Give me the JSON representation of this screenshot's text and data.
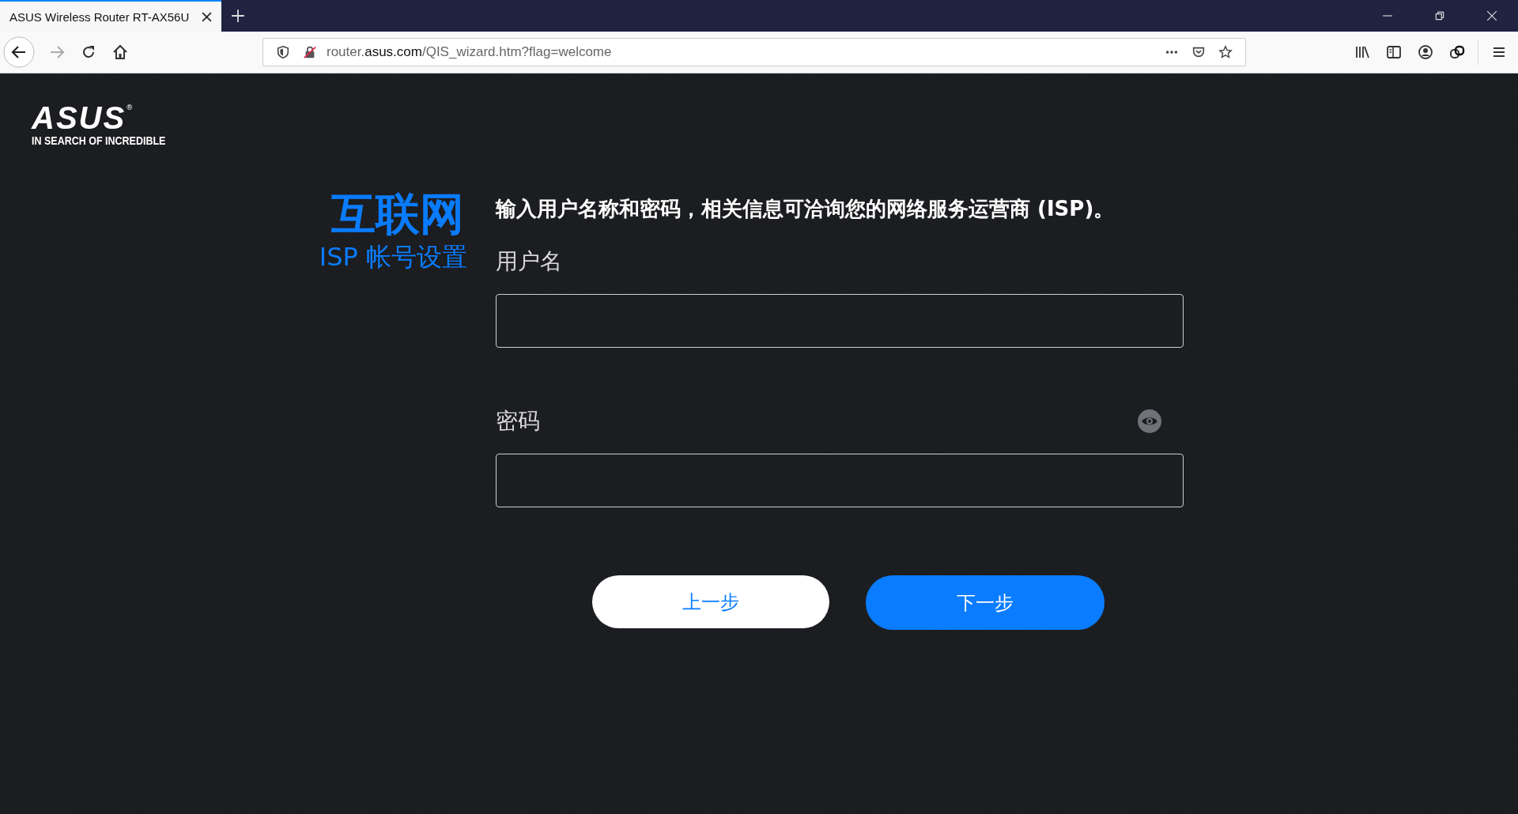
{
  "browser": {
    "tabs": [
      {
        "title": "ASUS Wireless Router RT-AX56U",
        "selected": true
      }
    ],
    "url": {
      "host_prefix": "router.",
      "host": "asus.com",
      "path": "/QIS_wizard.htm?flag=welcome"
    }
  },
  "logo": {
    "wordmark": "ASUS",
    "registered": "®",
    "tagline": "IN SEARCH OF INCREDIBLE"
  },
  "heading": {
    "title": "互联网",
    "subtitle": "ISP 帐号设置"
  },
  "description": "输入用户名称和密码，相关信息可洽询您的网络服务运营商 (ISP)。",
  "fields": [
    {
      "label": "用户名",
      "kind": "text"
    },
    {
      "label": "密码",
      "kind": "password"
    }
  ],
  "buttons": [
    {
      "label": "上一步",
      "kind": "secondary"
    },
    {
      "label": "下一步",
      "kind": "primary"
    }
  ]
}
